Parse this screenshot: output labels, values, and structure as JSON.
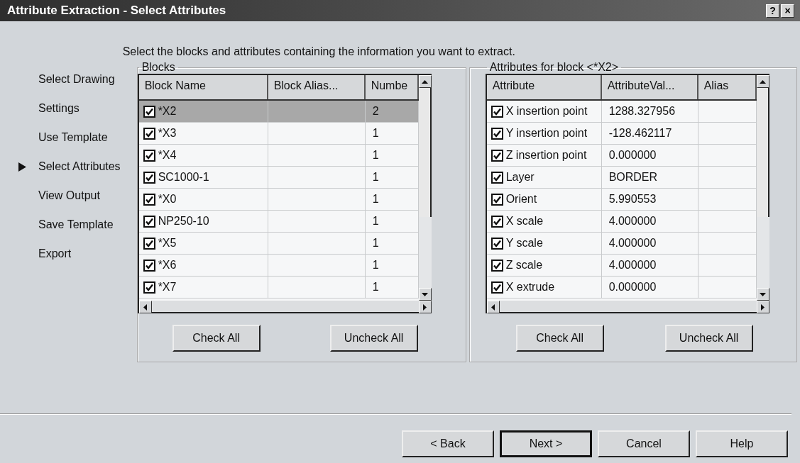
{
  "window": {
    "title": "Attribute Extraction - Select Attributes",
    "help_button": "?",
    "close_button": "×"
  },
  "sidebar": {
    "items": [
      {
        "label": "Select Drawing",
        "selected": false
      },
      {
        "label": "Settings",
        "selected": false
      },
      {
        "label": "Use Template",
        "selected": false
      },
      {
        "label": "Select Attributes",
        "selected": true
      },
      {
        "label": "View Output",
        "selected": false
      },
      {
        "label": "Save Template",
        "selected": false
      },
      {
        "label": "Export",
        "selected": false
      }
    ]
  },
  "instruction": "Select the blocks and attributes containing the information you want to extract.",
  "panels": [
    {
      "kind": "blocks",
      "title": "Blocks",
      "columns": [
        "Block Name",
        "Block Alias...",
        "Numbe"
      ],
      "rows": [
        {
          "checked": true,
          "selected": true,
          "name": "*X2",
          "value": "2"
        },
        {
          "checked": true,
          "selected": false,
          "name": "*X3",
          "value": "1"
        },
        {
          "checked": true,
          "selected": false,
          "name": "*X4",
          "value": "1"
        },
        {
          "checked": true,
          "selected": false,
          "name": "SC1000-1",
          "value": "1"
        },
        {
          "checked": true,
          "selected": false,
          "name": "*X0",
          "value": "1"
        },
        {
          "checked": true,
          "selected": false,
          "name": "NP250-10",
          "value": "1"
        },
        {
          "checked": true,
          "selected": false,
          "name": "*X5",
          "value": "1"
        },
        {
          "checked": true,
          "selected": false,
          "name": "*X6",
          "value": "1"
        },
        {
          "checked": true,
          "selected": false,
          "name": "*X7",
          "value": "1"
        }
      ],
      "buttons": [
        "Check All",
        "Uncheck All"
      ]
    },
    {
      "kind": "attributes",
      "title": "Attributes for block <*X2>",
      "columns": [
        "Attribute",
        "AttributeVal...",
        "Alias"
      ],
      "rows": [
        {
          "checked": true,
          "selected": false,
          "name": "X insertion point",
          "value": "1288.327956"
        },
        {
          "checked": true,
          "selected": false,
          "name": "Y insertion point",
          "value": "-128.462117"
        },
        {
          "checked": true,
          "selected": false,
          "name": "Z insertion point",
          "value": "0.000000"
        },
        {
          "checked": true,
          "selected": false,
          "name": "Layer",
          "value": "BORDER"
        },
        {
          "checked": true,
          "selected": false,
          "name": "Orient",
          "value": "5.990553"
        },
        {
          "checked": true,
          "selected": false,
          "name": "X scale",
          "value": "4.000000"
        },
        {
          "checked": true,
          "selected": false,
          "name": "Y scale",
          "value": "4.000000"
        },
        {
          "checked": true,
          "selected": false,
          "name": "Z scale",
          "value": "4.000000"
        },
        {
          "checked": true,
          "selected": false,
          "name": "X extrude",
          "value": "0.000000"
        }
      ],
      "buttons": [
        "Check All",
        "Uncheck All"
      ]
    }
  ],
  "footer_buttons": [
    {
      "label": "< Back",
      "default": false
    },
    {
      "label": "Next >",
      "default": true
    },
    {
      "label": "Cancel",
      "default": false
    },
    {
      "label": "Help",
      "default": false
    }
  ]
}
